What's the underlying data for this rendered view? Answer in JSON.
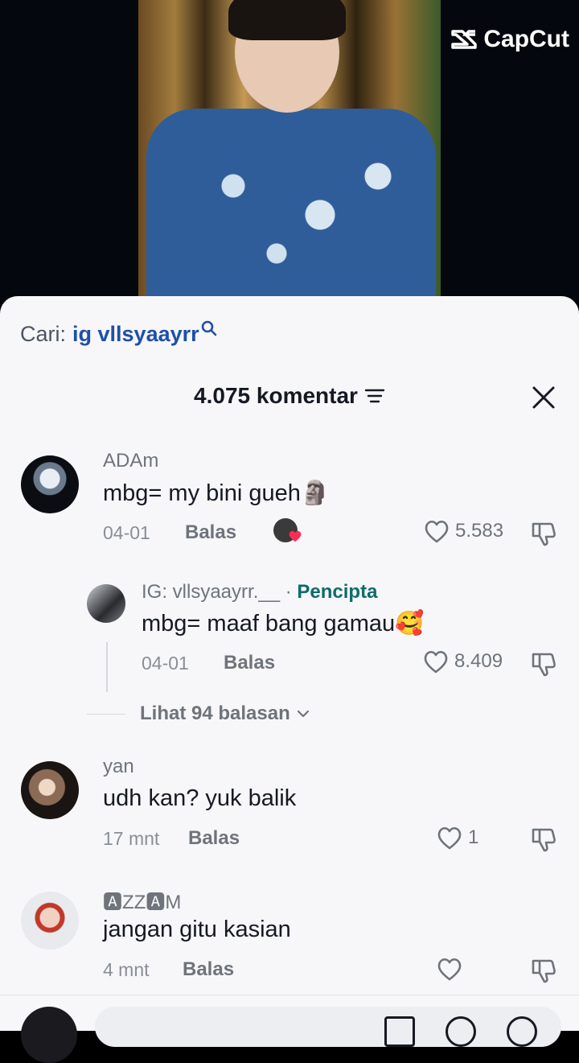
{
  "brand": {
    "name": "CapCut"
  },
  "search": {
    "prefix": "Cari:",
    "term": "ig vllsyaayrr"
  },
  "header": {
    "count_label": "4.075 komentar"
  },
  "comments": [
    {
      "username": "ADAm",
      "text": "mbg= my bini gueh🗿",
      "date": "04-01",
      "reply_label": "Balas",
      "likes": "5.583"
    },
    {
      "username": "IG: vllsyaayrr.__",
      "creator_label": "Pencipta",
      "text": "mbg= maaf bang gamau🥰",
      "date": "04-01",
      "reply_label": "Balas",
      "likes": "8.409"
    },
    {
      "username": "yan",
      "text": "udh kan? yuk balik",
      "date": "17 mnt",
      "reply_label": "Balas",
      "likes": "1"
    },
    {
      "username": "🅰ZZ🅰M",
      "text": "jangan gitu kasian",
      "date": "4 mnt",
      "reply_label": "Balas",
      "likes": ""
    }
  ],
  "thread": {
    "view_replies_label": "Lihat 94 balasan"
  },
  "colors": {
    "accent": "#1f4fa8",
    "creator": "#0f6b6b",
    "sheet": "#f7f7f9",
    "text": "#161823",
    "muted": "#6f737b"
  },
  "icons": [
    "search-icon",
    "filter-icon",
    "close-icon",
    "heart-icon",
    "dislike-icon",
    "chevron-down-icon"
  ]
}
